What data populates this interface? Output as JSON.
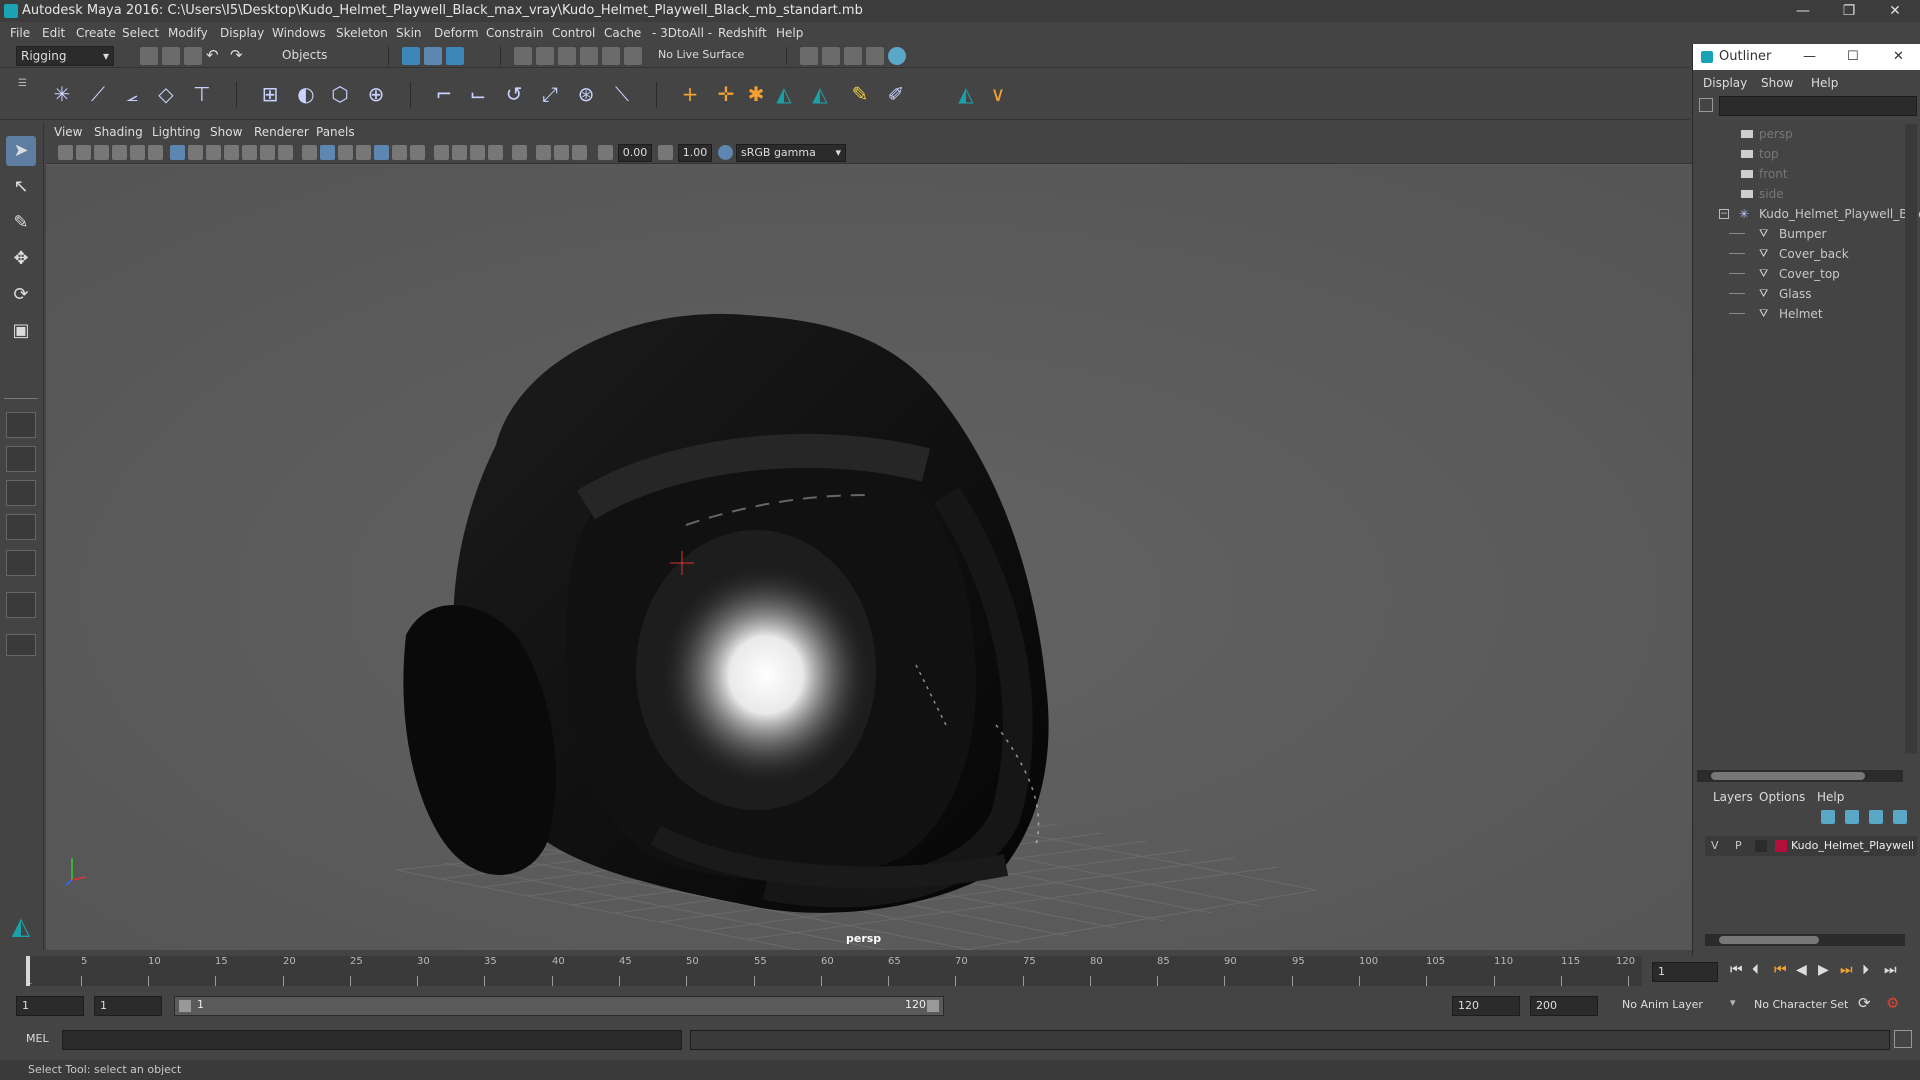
{
  "app": {
    "title": "Autodesk Maya 2016: C:\\Users\\I5\\Desktop\\Kudo_Helmet_Playwell_Black_max_vray\\Kudo_Helmet_Playwell_Black_mb_standart.mb",
    "window_controls": [
      "—",
      "❐",
      "✕"
    ]
  },
  "menubar": {
    "items": [
      "File",
      "Edit",
      "Create",
      "Select",
      "Modify",
      "Display",
      "Windows",
      "Skeleton",
      "Skin",
      "Deform",
      "Constrain",
      "Control",
      "Cache",
      "- 3DtoAll -",
      "Redshift",
      "Help"
    ]
  },
  "statusline": {
    "menuset": "Rigging",
    "selection_mode": "Objects",
    "live_surface": "No Live Surface"
  },
  "viewport": {
    "menu": [
      "View",
      "Shading",
      "Lighting",
      "Show",
      "Renderer",
      "Panels"
    ],
    "exposure": "0.00",
    "gamma": "1.00",
    "color_space": "sRGB gamma",
    "camera_label": "persp"
  },
  "outliner": {
    "title": "Outliner",
    "window_controls": [
      "—",
      "☐",
      "✕"
    ],
    "menu": [
      "Display",
      "Show",
      "Help"
    ],
    "cameras": [
      "persp",
      "top",
      "front",
      "side"
    ],
    "group": "Kudo_Helmet_Playwell_Black_",
    "children": [
      "Bumper",
      "Cover_back",
      "Cover_top",
      "Glass",
      "Helmet"
    ]
  },
  "layers": {
    "menu": [
      "Layers",
      "Options",
      "Help"
    ],
    "row": {
      "v": "V",
      "p": "P",
      "name": "Kudo_Helmet_Playwell",
      "color": "#b0103a"
    }
  },
  "timeslider": {
    "ticks": [
      "1",
      "5",
      "10",
      "15",
      "20",
      "25",
      "30",
      "35",
      "40",
      "45",
      "50",
      "55",
      "60",
      "65",
      "70",
      "75",
      "80",
      "85",
      "90",
      "95",
      "100",
      "105",
      "110",
      "115",
      "120"
    ],
    "current_frame": "1"
  },
  "rangeslider": {
    "start": "1",
    "current": "1",
    "range_start_label": "1",
    "range_end_label": "120",
    "end": "120",
    "max": "200",
    "anim_layer": "No Anim Layer",
    "character_set": "No Character Set"
  },
  "cmdline": {
    "label": "MEL"
  },
  "helpline": {
    "text": "Select Tool: select an object"
  },
  "colors": {
    "viewport_bg": "#5b5b5b",
    "ui_bg": "#444444",
    "accent": "#5d86b0",
    "maya_teal": "#1aa3b5"
  }
}
